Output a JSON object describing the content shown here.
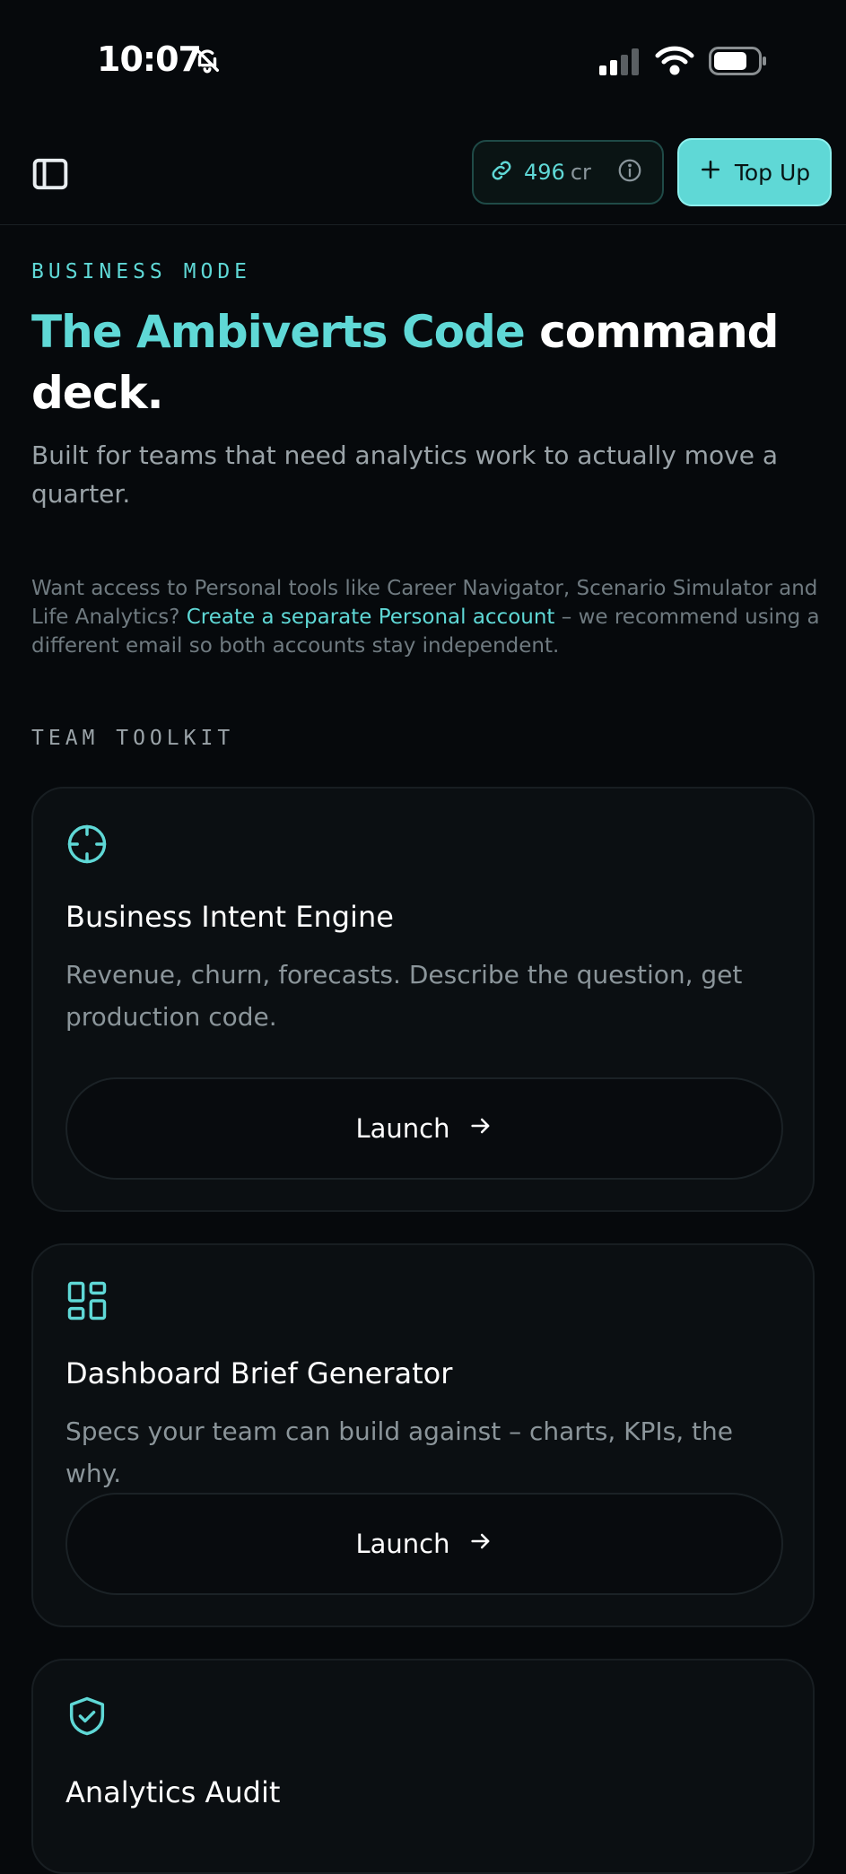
{
  "status_bar": {
    "time": "10:07"
  },
  "header": {
    "credits_value": "496",
    "credits_unit": "cr",
    "topup_label": "Top Up"
  },
  "hero": {
    "eyebrow": "BUSINESS MODE",
    "title_accent": "The Ambiverts Code",
    "title_rest": " command deck.",
    "subtitle": "Built for teams that need analytics work to actually move a quarter.",
    "note_prefix": "Want access to Personal tools like Career Navigator, Scenario Simulator and Life Analytics? ",
    "note_link": "Create a separate Personal account",
    "note_suffix": " – we recommend using a different email so both accounts stay independent."
  },
  "toolkit": {
    "label": "TEAM TOOLKIT",
    "cards": [
      {
        "icon": "crosshair-icon",
        "title": "Business Intent Engine",
        "description": "Revenue, churn, forecasts. Describe the question, get production code.",
        "button": "Launch"
      },
      {
        "icon": "dashboard-grid-icon",
        "title": "Dashboard Brief Generator",
        "description": "Specs your team can build against – charts, KPIs, the why.",
        "button": "Launch"
      },
      {
        "icon": "shield-check-icon",
        "title": "Analytics Audit"
      }
    ]
  },
  "colors": {
    "accent": "#5fd8d6",
    "background": "#06090c",
    "card": "#0b0f12"
  }
}
